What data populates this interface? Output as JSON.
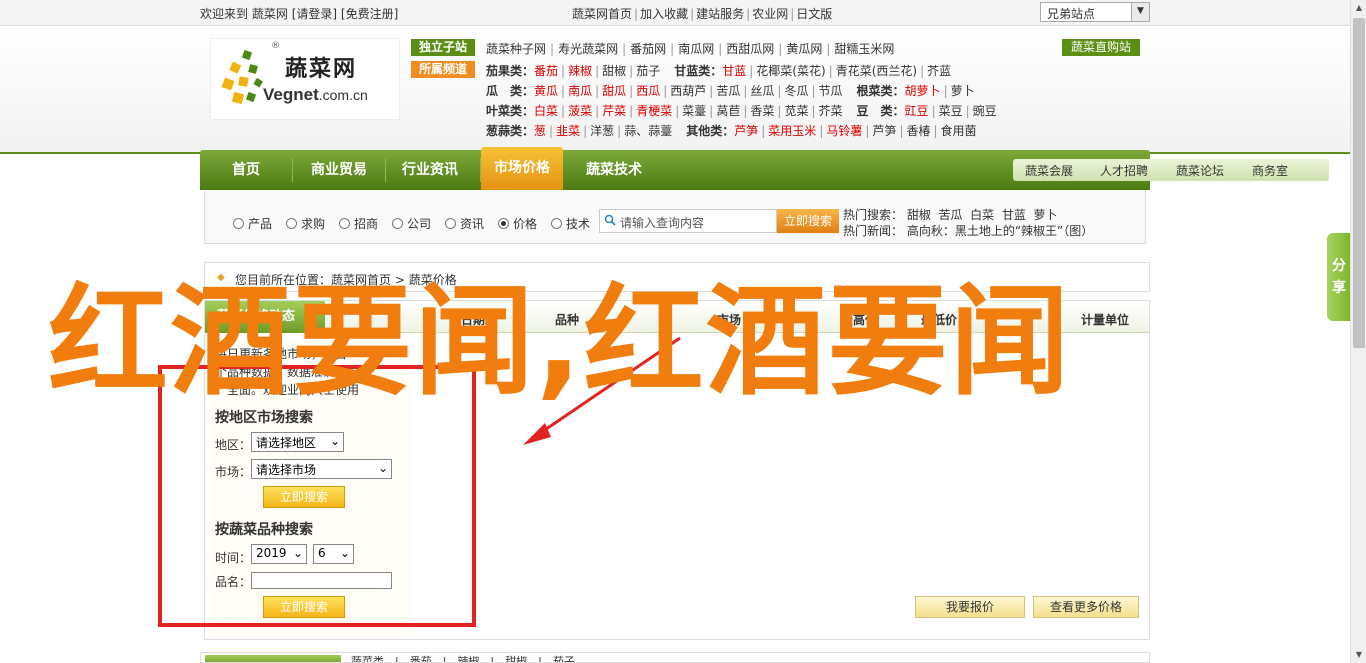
{
  "topbar": {
    "welcome": "欢迎来到",
    "site": "蔬菜网",
    "login": "[请登录]",
    "register": "[免费注册]",
    "links": [
      "蔬菜网首页",
      "加入收藏",
      "建站服务",
      "农业网",
      "日文版"
    ],
    "site_select": "兄弟站点"
  },
  "header": {
    "logo_cn": "蔬菜网",
    "logo_en_a": "Vegnet",
    "logo_en_b": ".com.cn",
    "logo_reg": "®",
    "tag_sites": "独立子站",
    "tag_channels": "所属频道",
    "site_links": [
      "蔬菜种子网",
      "寿光蔬菜网",
      "番茄网",
      "南瓜网",
      "西甜瓜网",
      "黄瓜网",
      "甜糯玉米网"
    ],
    "mall": "蔬菜直购站",
    "categories": [
      {
        "key": "茄果类：",
        "items": [
          [
            "番茄",
            true
          ],
          [
            "辣椒",
            true
          ],
          [
            "甜椒",
            false
          ],
          [
            "茄子",
            false
          ]
        ],
        "key2": "甘蓝类：",
        "items2": [
          [
            "甘蓝",
            true
          ],
          [
            "花椰菜(菜花)",
            false
          ],
          [
            "青花菜(西兰花)",
            false
          ],
          [
            "芥蓝",
            false
          ]
        ]
      },
      {
        "key": "瓜　类：",
        "items": [
          [
            "黄瓜",
            true
          ],
          [
            "南瓜",
            true
          ],
          [
            "甜瓜",
            true
          ],
          [
            "西瓜",
            true
          ],
          [
            "西葫芦",
            false
          ],
          [
            "苦瓜",
            false
          ],
          [
            "丝瓜",
            false
          ],
          [
            "冬瓜",
            false
          ],
          [
            "节瓜",
            false
          ]
        ],
        "key2": "根菜类：",
        "items2": [
          [
            "胡萝卜",
            true
          ],
          [
            "萝卜",
            false
          ]
        ]
      },
      {
        "key": "叶菜类：",
        "items": [
          [
            "白菜",
            true
          ],
          [
            "菠菜",
            true
          ],
          [
            "芹菜",
            true
          ],
          [
            "青梗菜",
            true
          ],
          [
            "菜薹",
            false
          ],
          [
            "莴苣",
            false
          ],
          [
            "香菜",
            false
          ],
          [
            "苋菜",
            false
          ],
          [
            "芥菜",
            false
          ]
        ],
        "key2": "豆　类：",
        "items2": [
          [
            "豇豆",
            true
          ],
          [
            "菜豆",
            false
          ],
          [
            "豌豆",
            false
          ]
        ]
      },
      {
        "key": "葱蒜类：",
        "items": [
          [
            "葱",
            true
          ],
          [
            "韭菜",
            true
          ],
          [
            "洋葱",
            false
          ],
          [
            "蒜、蒜薹",
            false
          ]
        ],
        "key2": "其他类：",
        "items2": [
          [
            "芦笋",
            true
          ],
          [
            "菜用玉米",
            true
          ],
          [
            "马铃薯",
            true
          ],
          [
            "芦笋",
            false
          ],
          [
            "香椿",
            false
          ],
          [
            "食用菌",
            false
          ]
        ]
      }
    ]
  },
  "nav": {
    "items": [
      "首页",
      "商业贸易",
      "行业资讯",
      "市场价格",
      "蔬菜技术"
    ],
    "active": "市场价格",
    "sub": [
      "蔬菜会展",
      "人才招聘",
      "蔬菜论坛",
      "商务室"
    ]
  },
  "search": {
    "radios": [
      "产品",
      "求购",
      "招商",
      "公司",
      "资讯",
      "价格",
      "技术"
    ],
    "checked": "价格",
    "placeholder": "请输入查询内容",
    "button": "立即搜索",
    "hot_label": "热门搜索：",
    "hot": [
      "甜椒",
      "苦瓜",
      "白菜",
      "甘蓝",
      "萝卜"
    ],
    "news_label": "热门新闻：",
    "news": "高向秋：黑土地上的“辣椒王”（图）"
  },
  "breadcrumb": {
    "prefix": "您目前所在位置：",
    "home": "蔬菜网首页",
    "current": "蔬菜价格"
  },
  "table": {
    "title": "蔬菜价格动态",
    "headers": [
      "日期",
      "品种",
      "市场",
      "最高价",
      "最低价",
      "计量单位"
    ]
  },
  "panel": {
    "intro1": "每日更新各地市场，上百",
    "intro2": "个品种数据，数据准确",
    "intro3": "、全面。欢迎业内人士使用",
    "region_title": "按地区市场搜索",
    "region_label": "地区：",
    "region_value": "请选择地区",
    "market_label": "市场：",
    "market_value": "请选择市场",
    "search_btn": "立即搜索",
    "variety_title": "按蔬菜品种搜索",
    "time_label": "时间：",
    "year": "2019",
    "month": "6",
    "name_label": "品名：",
    "name_value": "",
    "search_btn2": "立即搜索"
  },
  "actions": {
    "report": "我要报价",
    "more": "查看更多价格"
  },
  "bottom": {
    "text": "蔬菜类　|　番茄　|　辣椒　|　甜椒　|　茄子"
  },
  "share": "分享",
  "overlay": {
    "title": "红酒要闻,红酒要闻"
  },
  "colors": {
    "brand_green": "#5e8f1c",
    "nav_active": "#e59211",
    "highlight_red": "#d00000",
    "overlay_orange": "#f07d0d",
    "box_red": "#e32222"
  }
}
